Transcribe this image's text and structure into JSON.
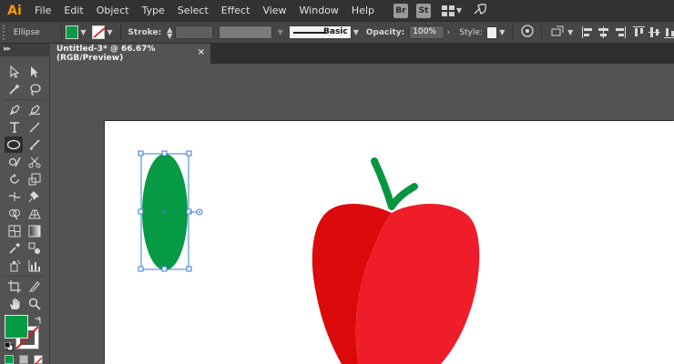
{
  "app": {
    "logo": "Ai"
  },
  "menu": [
    "File",
    "Edit",
    "Object",
    "Type",
    "Select",
    "Effect",
    "View",
    "Window",
    "Help"
  ],
  "app_buttons": {
    "bridge": "Br",
    "stock": "St"
  },
  "control_bar": {
    "tool_name": "Ellipse",
    "fill_color": "#069a44",
    "stroke_label": "Stroke:",
    "brush_label": "Basic",
    "opacity_label": "Opacity:",
    "opacity_value": "100%",
    "style_label": "Style:"
  },
  "document": {
    "tab_title": "Untitled-3* @ 66.67% (RGB/Preview)",
    "close_glyph": "×"
  },
  "artwork": {
    "ellipse_color": "#069a44",
    "apple_dark": "#dc0a0a",
    "apple_light": "#ef1c2a",
    "stem_color": "#07963f",
    "selection_color": "#3a7bd5"
  }
}
